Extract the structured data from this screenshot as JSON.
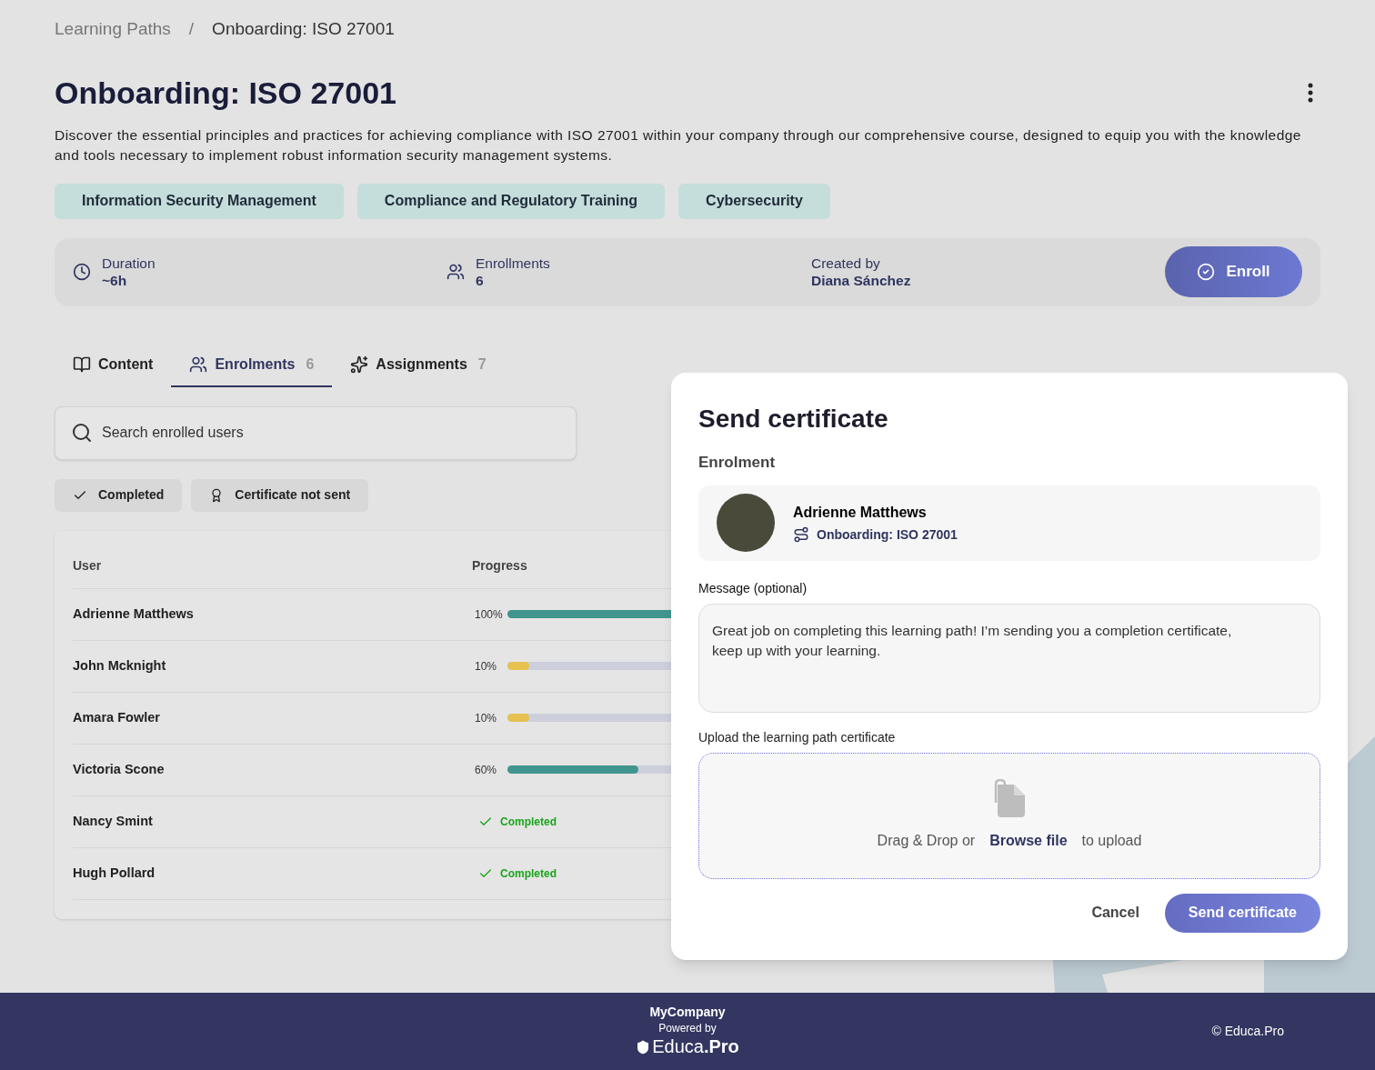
{
  "breadcrumb": [
    {
      "label": "Learning Paths"
    },
    {
      "label": "Onboarding: ISO 27001"
    }
  ],
  "separator": "/",
  "title": "Onboarding: ISO 27001",
  "description": "Discover the essential principles and practices for achieving compliance with ISO 27001 within your company through our comprehensive course, designed to equip you with the knowledge and tools necessary to implement robust information security management systems.",
  "tags": [
    "Information Security Management",
    "Compliance and Regulatory Training",
    "Cybersecurity"
  ],
  "stats": [
    {
      "kind": "duration",
      "label": "Duration",
      "value": "~6h"
    },
    {
      "kind": "enrollments",
      "label": "Enrollments",
      "value": "6"
    },
    {
      "kind": "creator",
      "label": "Created by",
      "value": "Diana Sánchez"
    }
  ],
  "enroll_button": "Enroll",
  "tabs": [
    {
      "kind": "content",
      "label": "Content",
      "selected": false
    },
    {
      "kind": "enrolments",
      "label": "Enrolments",
      "count": "6",
      "selected": true
    },
    {
      "kind": "assignments",
      "label": "Assignments",
      "count": "7",
      "selected": false
    }
  ],
  "search": {
    "placeholder": "Search enrolled users"
  },
  "filters": [
    {
      "kind": "completed",
      "label": "Completed"
    },
    {
      "kind": "certificate",
      "label": "Certificate not sent"
    }
  ],
  "table": {
    "columns": [
      "User",
      "Progress"
    ],
    "rows": [
      {
        "name": "Adrienne Matthews",
        "kind": "bar",
        "percent": "100%",
        "level": 1
      },
      {
        "name": "John Mcknight",
        "kind": "bar",
        "percent": "10%",
        "level": 0.1
      },
      {
        "name": "Amara Fowler",
        "kind": "bar",
        "percent": "10%",
        "level": 0.1
      },
      {
        "name": "Victoria Scone",
        "kind": "bar",
        "percent": "60%",
        "level": 0.6
      },
      {
        "name": "Nancy Smint",
        "kind": "completed",
        "status": "Completed"
      },
      {
        "name": "Hugh Pollard",
        "kind": "completed",
        "status": "Completed"
      }
    ]
  },
  "modal": {
    "title": "Send certificate",
    "section": "Enrolment",
    "user": "Adrienne Matthews",
    "path": "Onboarding: ISO 27001",
    "message_label": "Message (optional)",
    "message": "Great job on completing this learning path! I’m sending you a completion certificate, keep up with your learning.",
    "upload_label": "Upload the learning path certificate",
    "upload_before": "Drag & Drop or",
    "upload_link": "Browse file",
    "upload_after": "to upload",
    "cancel": "Cancel",
    "submit": "Send certificate"
  },
  "footer": {
    "company": "MyCompany",
    "powered": "Powered by",
    "brand": "Educa**.Pro**",
    "copyright": "© Educa.Pro"
  }
}
